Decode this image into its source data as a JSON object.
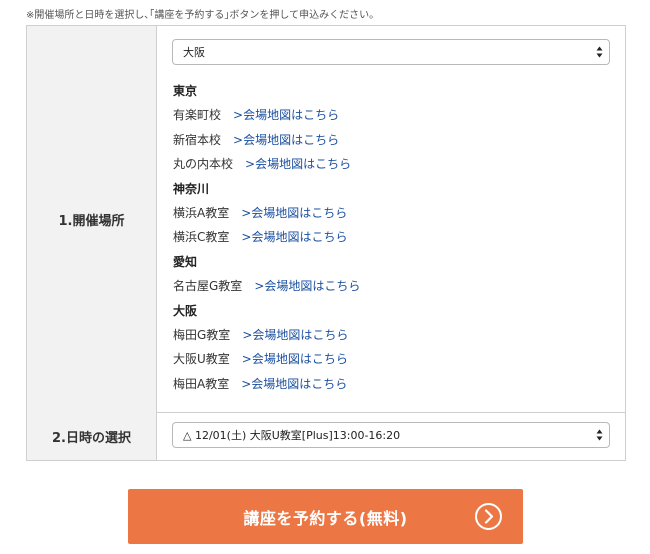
{
  "note": "※開催場所と日時を選択し､｢講座を予約する｣ボタンを押して申込みください。",
  "place_row": {
    "label": "1.開催場所",
    "select_value": "大阪",
    "regions": [
      {
        "name": "東京",
        "venues": [
          {
            "name": "有楽町校",
            "link": ">会場地図はこちら"
          },
          {
            "name": "新宿本校",
            "link": ">会場地図はこちら"
          },
          {
            "name": "丸の内本校",
            "link": ">会場地図はこちら"
          }
        ]
      },
      {
        "name": "神奈川",
        "venues": [
          {
            "name": "横浜A教室",
            "link": ">会場地図はこちら"
          },
          {
            "name": "横浜C教室",
            "link": ">会場地図はこちら"
          }
        ]
      },
      {
        "name": "愛知",
        "venues": [
          {
            "name": "名古屋G教室",
            "link": ">会場地図はこちら"
          }
        ]
      },
      {
        "name": "大阪",
        "venues": [
          {
            "name": "梅田G教室",
            "link": ">会場地図はこちら"
          },
          {
            "name": "大阪U教室",
            "link": ">会場地図はこちら"
          },
          {
            "name": "梅田A教室",
            "link": ">会場地図はこちら"
          }
        ]
      }
    ]
  },
  "date_row": {
    "label": "2.日時の選択",
    "select_value": "△ 12/01(土) 大阪U教室[Plus]13:00-16:20"
  },
  "cta": {
    "label": "講座を予約する(無料)",
    "icon": "chevron-right-circle-icon"
  },
  "colors": {
    "cta_background": "#ec7744",
    "link": "#1a4fa0",
    "label_background": "#f2f2f2",
    "border": "#cfcfcf"
  }
}
